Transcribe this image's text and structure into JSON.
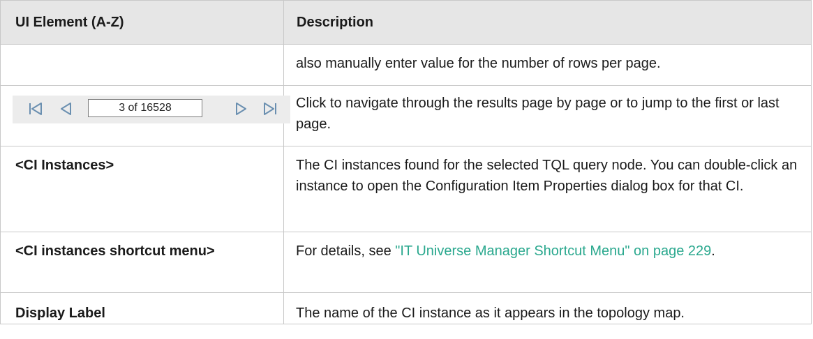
{
  "header": {
    "col_element": "UI Element (A-Z)",
    "col_description": "Description"
  },
  "rows": [
    {
      "element": "",
      "description": "also manually enter value for the number of rows per page."
    },
    {
      "element_widget": {
        "icons": [
          "first-page-icon",
          "previous-page-icon",
          "next-page-icon",
          "last-page-icon"
        ],
        "field_value": "3 of 16528"
      },
      "description": "Click to navigate through the results page by page or to jump to the first or last page."
    },
    {
      "element": "<CI Instances>",
      "description": "The CI instances found for the selected TQL query node. You can double-click an instance to open the Configuration Item Properties dialog box for that CI."
    },
    {
      "element": "<CI instances shortcut menu>",
      "description_prefix": "For details, see ",
      "description_link": "\"IT Universe Manager Shortcut Menu\" on page 229",
      "description_suffix": "."
    },
    {
      "element": "Display Label",
      "description": "The name of the CI instance as it appears in the topology map."
    }
  ],
  "colors": {
    "header_bg": "#e6e6e6",
    "border": "#c8c8c8",
    "link": "#2aa88e"
  }
}
